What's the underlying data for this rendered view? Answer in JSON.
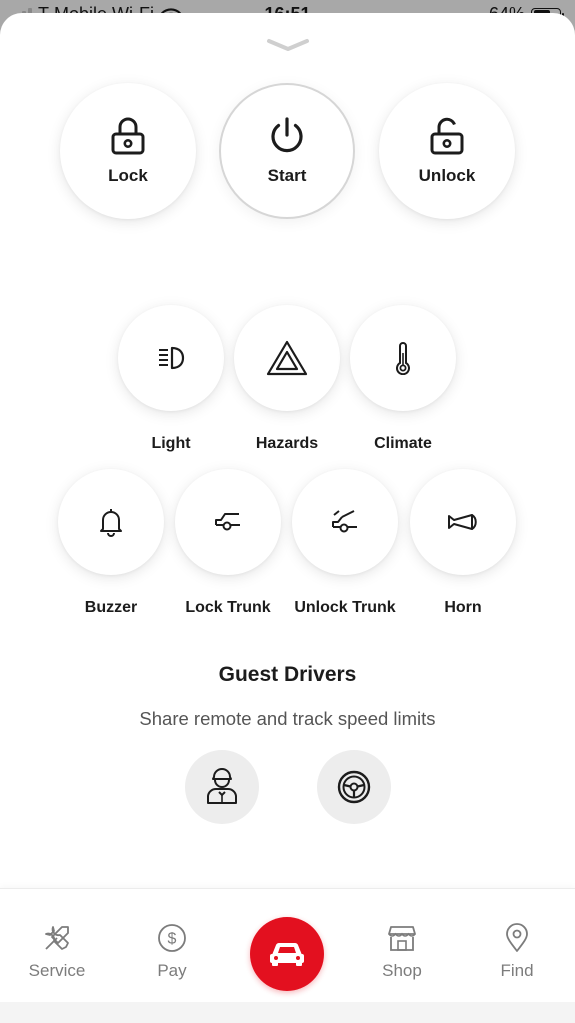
{
  "status_bar": {
    "carrier": "T-Mobile Wi-Fi",
    "time": "16:51",
    "battery_percent": "64%",
    "battery_level": 0.64
  },
  "primary_controls": [
    {
      "label": "Lock",
      "icon": "lock-icon"
    },
    {
      "label": "Start",
      "icon": "power-icon"
    },
    {
      "label": "Unlock",
      "icon": "unlock-icon"
    }
  ],
  "secondary_controls": [
    {
      "label": "Light",
      "icon": "headlight-icon"
    },
    {
      "label": "Hazards",
      "icon": "hazard-icon"
    },
    {
      "label": "Climate",
      "icon": "thermometer-icon"
    }
  ],
  "tertiary_controls": [
    {
      "label": "Buzzer",
      "icon": "bell-icon"
    },
    {
      "label": "Lock Trunk",
      "icon": "trunk-lock-icon"
    },
    {
      "label": "Unlock Trunk",
      "icon": "trunk-unlock-icon"
    },
    {
      "label": "Horn",
      "icon": "horn-icon"
    }
  ],
  "guest_drivers": {
    "title": "Guest Drivers",
    "subtitle": "Share remote and track speed limits",
    "buttons": [
      {
        "icon": "valet-icon"
      },
      {
        "icon": "steering-wheel-icon"
      }
    ]
  },
  "tab_bar": {
    "items": [
      {
        "label": "Service",
        "icon": "tools-icon"
      },
      {
        "label": "Pay",
        "icon": "dollar-icon"
      },
      {
        "label": "",
        "icon": "car-icon",
        "active": true
      },
      {
        "label": "Shop",
        "icon": "store-icon"
      },
      {
        "label": "Find",
        "icon": "location-pin-icon"
      }
    ],
    "accent_color": "#e3101f"
  }
}
